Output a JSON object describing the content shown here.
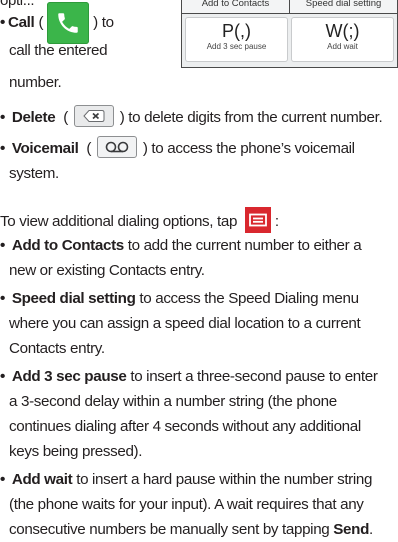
{
  "partial_header": "opti...",
  "dialer": {
    "tabs": [
      "Add to Contacts",
      "Speed dial setting"
    ],
    "keys": [
      {
        "symbol": "P(,)",
        "caption": "Add 3 sec pause"
      },
      {
        "symbol": "W(;)",
        "caption": "Add wait"
      }
    ]
  },
  "call": {
    "bullet": "•",
    "term": "Call",
    "line1_open": "(",
    "line1_close": ") to",
    "line2": "call the entered",
    "line3": "number."
  },
  "delete": {
    "bullet": "•",
    "term": "Delete",
    "open": "(",
    "rest": ") to delete digits from the current number."
  },
  "voicemail": {
    "bullet": "•",
    "term": "Voicemail",
    "open": "(",
    "rest": ") to access the phone’s voicemail",
    "line2": "system."
  },
  "intro": "To view additional dialing options, tap",
  "intro_suffix": ":",
  "options": [
    {
      "term": "Add to Contacts",
      "lines": [
        " to add the current number to either a",
        "new or existing Contacts entry."
      ]
    },
    {
      "term": "Speed dial setting",
      "lines": [
        " to access the Speed Dialing menu",
        "where you can assign a speed dial location to a current",
        "Contacts entry."
      ]
    },
    {
      "term": "Add 3 sec pause",
      "lines": [
        " to insert a three-second pause to enter",
        "a 3-second delay within a number string (the phone",
        "continues dialing after 4 seconds without any additional",
        "keys being pressed)."
      ]
    },
    {
      "term": "Add wait",
      "lines": [
        " to insert a hard pause within the number string",
        "(the phone waits for your input). A wait requires that any",
        "consecutive numbers be manually sent by tapping "
      ],
      "tail_term": "Send",
      "tail": "."
    }
  ],
  "icons": {
    "call": "phone-handset-icon",
    "delete": "backspace-delete-icon",
    "voicemail": "voicemail-icon",
    "menu": "menu-icon"
  },
  "colors": {
    "call_green": "#3bb54a",
    "menu_red": "#d9272e",
    "text": "#231f20"
  }
}
